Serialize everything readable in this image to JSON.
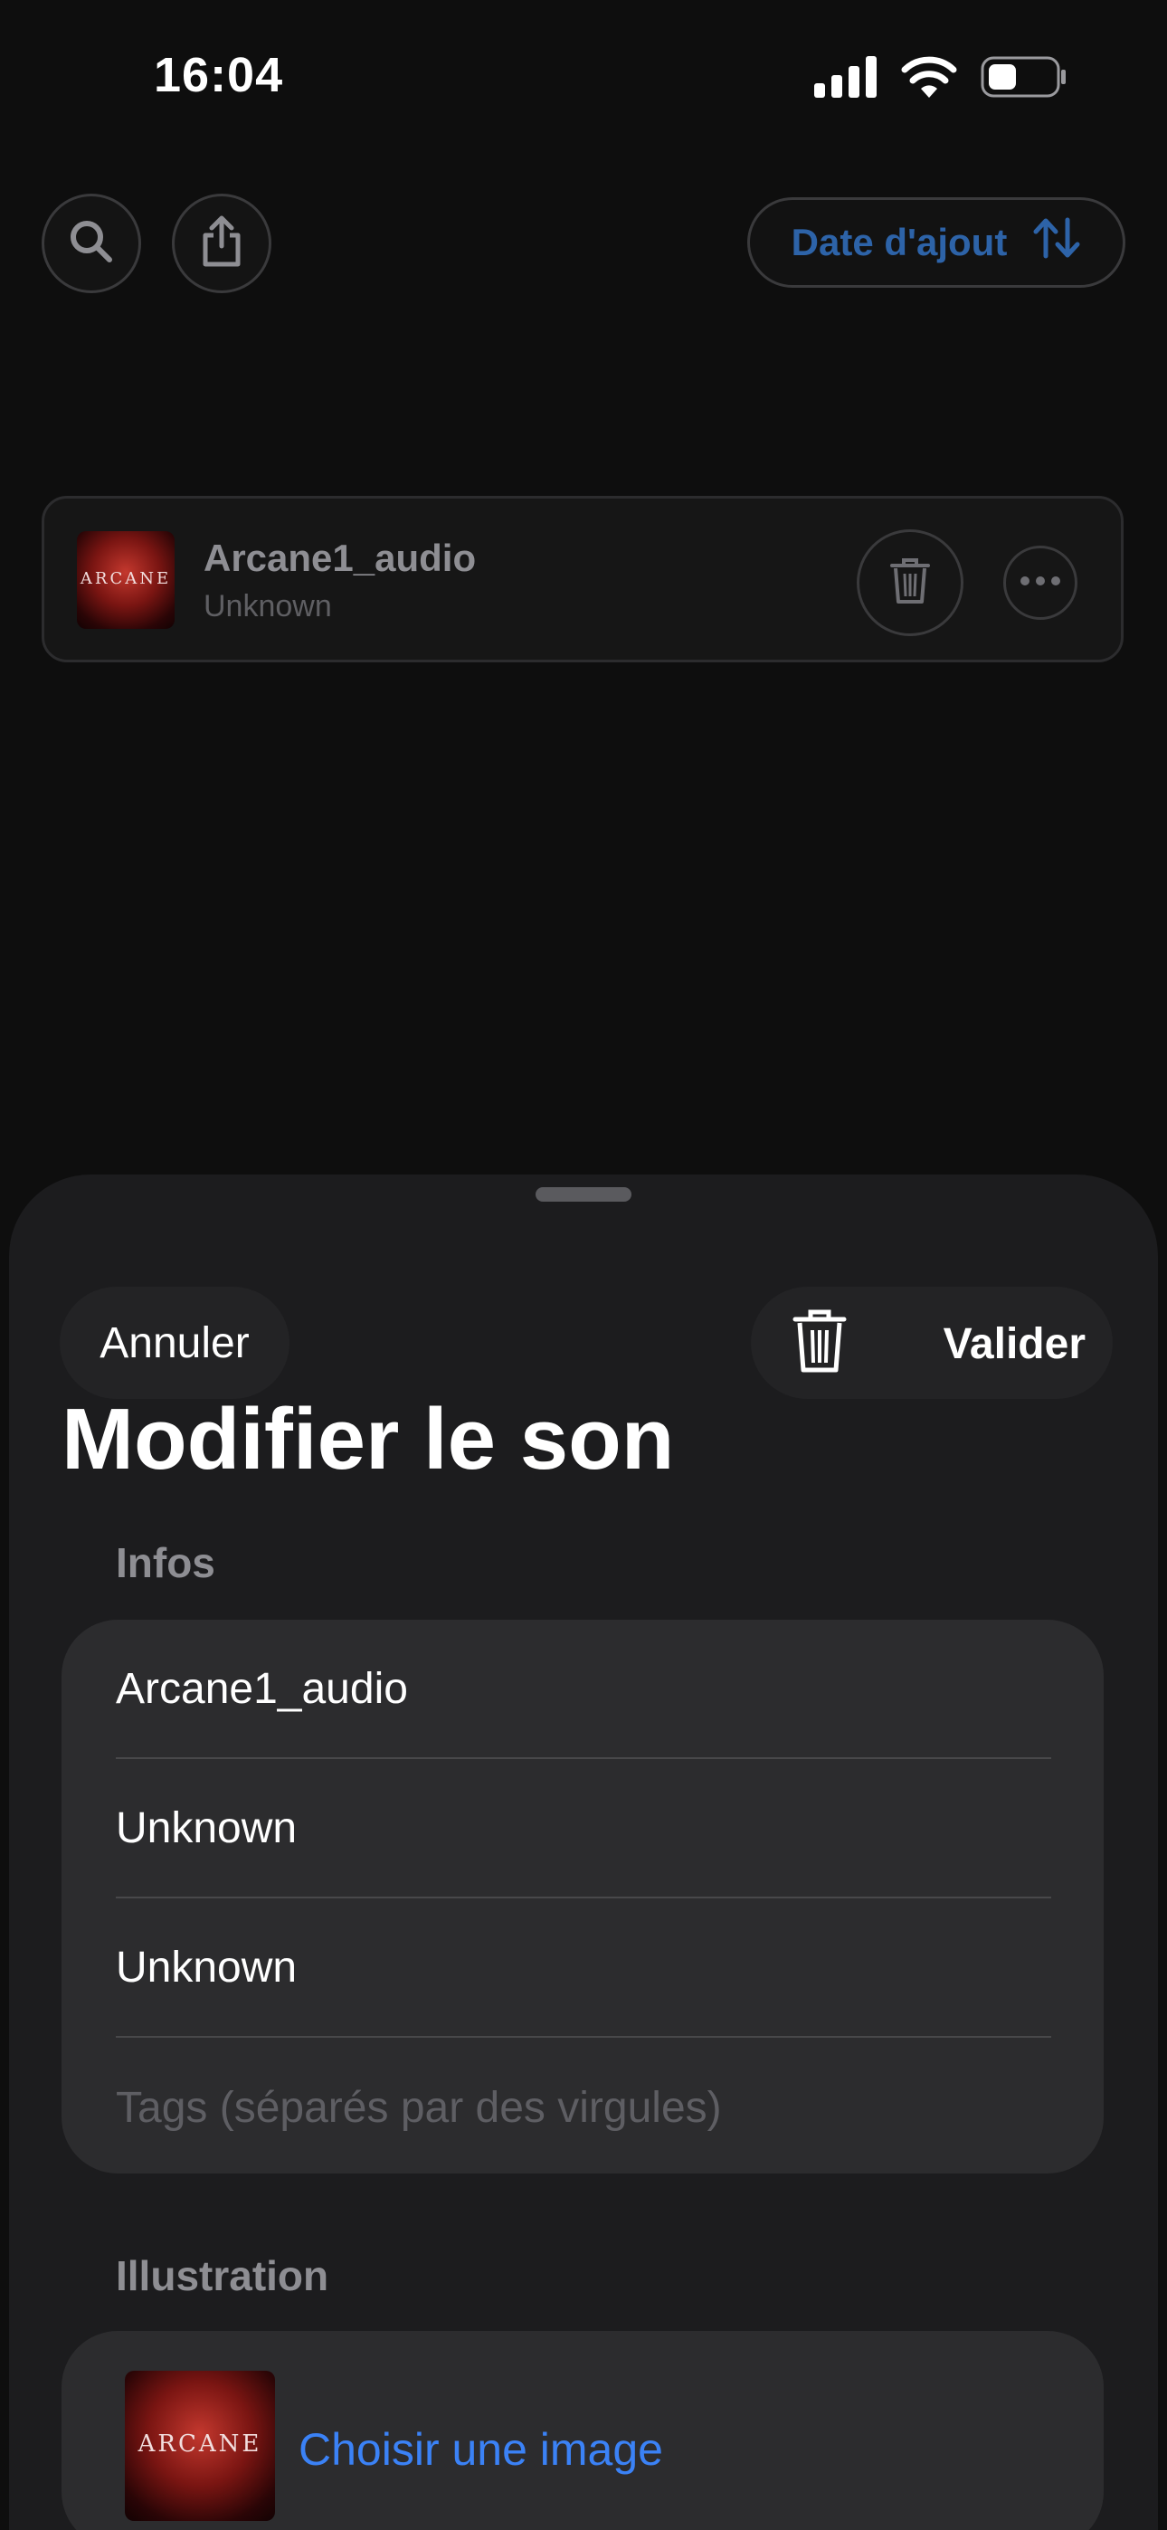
{
  "status_bar": {
    "time": "16:04",
    "icons": [
      "cellular-signal-icon",
      "wifi-icon",
      "battery-icon"
    ]
  },
  "toolbar": {
    "search_icon": "search-icon",
    "share_icon": "share-icon",
    "sort_label": "Date d'ajout",
    "sort_icon": "sort-arrows-icon"
  },
  "track": {
    "title": "Arcane1_audio",
    "artist": "Unknown",
    "cover_text": "ARCANE"
  },
  "sheet": {
    "cancel_label": "Annuler",
    "validate_label": "Valider",
    "title": "Modifier le son",
    "infos_label": "Infos",
    "fields": {
      "title_value": "Arcane1_audio",
      "artist_value": "Unknown",
      "album_value": "Unknown",
      "tags_placeholder": "Tags (séparés par des virgules)"
    },
    "illustration_label": "Illustration",
    "choose_image_label": "Choisir une image",
    "cover_text": "ARCANE"
  },
  "colors": {
    "background": "#0e0e0e",
    "sheet": "#1c1c1e",
    "card": "#2c2c2e",
    "accent_blue": "#3b82f6",
    "sort_blue": "#2d63a8"
  }
}
